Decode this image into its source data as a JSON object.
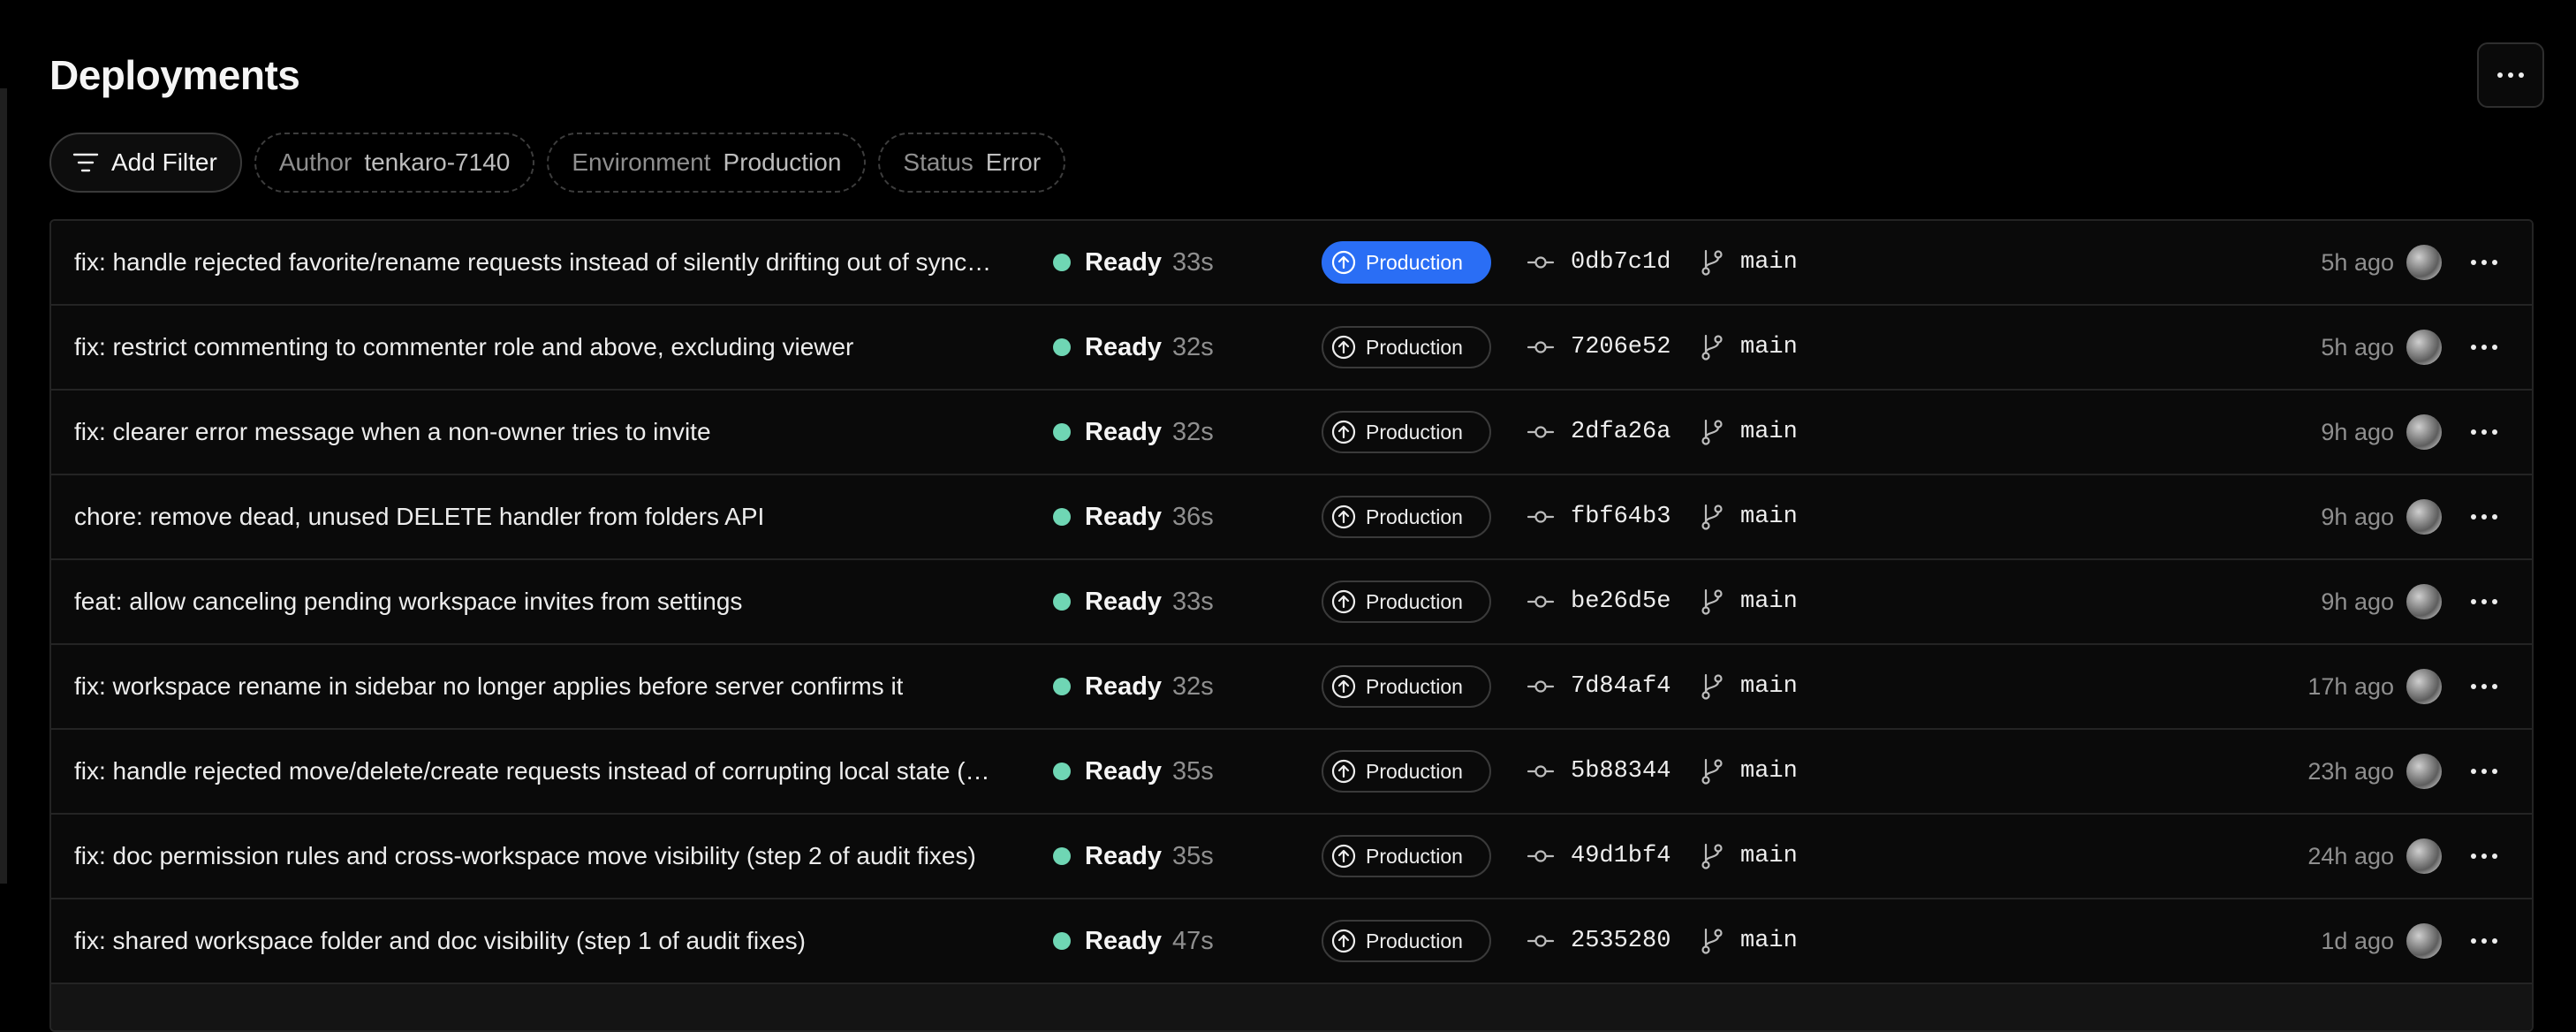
{
  "page": {
    "title": "Deployments"
  },
  "filters": {
    "add_label": "Add Filter",
    "chips": [
      {
        "key": "Author",
        "value": "tenkaro-7140"
      },
      {
        "key": "Environment",
        "value": "Production"
      },
      {
        "key": "Status",
        "value": "Error"
      }
    ]
  },
  "colors": {
    "ready_dot": "#6fd6b4",
    "active_env": "#2a6ef5"
  },
  "deployments": [
    {
      "message": "fix: handle rejected favorite/rename requests instead of silently drifting out of sync…",
      "status": "Ready",
      "duration": "33s",
      "environment": "Production",
      "commit": "0db7c1d",
      "branch": "main",
      "time": "5h ago"
    },
    {
      "message": "fix: restrict commenting to commenter role and above, excluding viewer",
      "status": "Ready",
      "duration": "32s",
      "environment": "Production",
      "commit": "7206e52",
      "branch": "main",
      "time": "5h ago"
    },
    {
      "message": "fix: clearer error message when a non-owner tries to invite",
      "status": "Ready",
      "duration": "32s",
      "environment": "Production",
      "commit": "2dfa26a",
      "branch": "main",
      "time": "9h ago"
    },
    {
      "message": "chore: remove dead, unused DELETE handler from folders API",
      "status": "Ready",
      "duration": "36s",
      "environment": "Production",
      "commit": "fbf64b3",
      "branch": "main",
      "time": "9h ago"
    },
    {
      "message": "feat: allow canceling pending workspace invites from settings",
      "status": "Ready",
      "duration": "33s",
      "environment": "Production",
      "commit": "be26d5e",
      "branch": "main",
      "time": "9h ago"
    },
    {
      "message": "fix: workspace rename in sidebar no longer applies before server confirms it",
      "status": "Ready",
      "duration": "32s",
      "environment": "Production",
      "commit": "7d84af4",
      "branch": "main",
      "time": "17h ago"
    },
    {
      "message": "fix: handle rejected move/delete/create requests instead of corrupting local state (…",
      "status": "Ready",
      "duration": "35s",
      "environment": "Production",
      "commit": "5b88344",
      "branch": "main",
      "time": "23h ago"
    },
    {
      "message": "fix: doc permission rules and cross-workspace move visibility (step 2 of audit fixes)",
      "status": "Ready",
      "duration": "35s",
      "environment": "Production",
      "commit": "49d1bf4",
      "branch": "main",
      "time": "24h ago"
    },
    {
      "message": "fix: shared workspace folder and doc visibility (step 1 of audit fixes)",
      "status": "Ready",
      "duration": "47s",
      "environment": "Production",
      "commit": "2535280",
      "branch": "main",
      "time": "1d ago"
    }
  ]
}
